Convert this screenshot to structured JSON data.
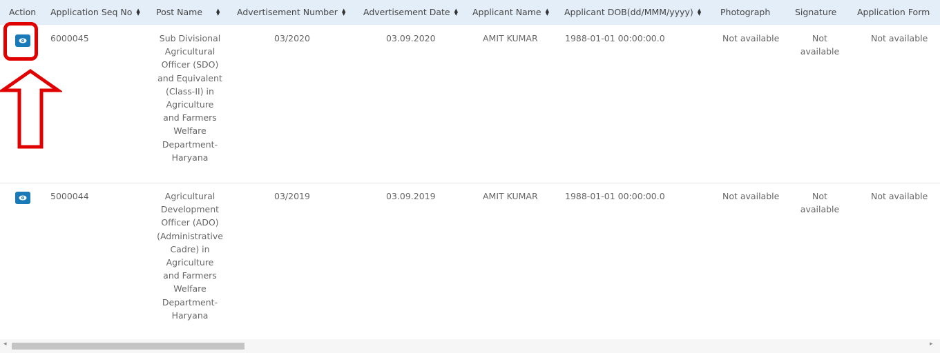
{
  "table": {
    "columns": [
      {
        "label": "Action",
        "sortable": false
      },
      {
        "label": "Application Seq No",
        "sortable": true
      },
      {
        "label": "Post Name",
        "sortable": true
      },
      {
        "label": "Advertisement Number",
        "sortable": true
      },
      {
        "label": "Advertisement Date",
        "sortable": true
      },
      {
        "label": "Applicant Name",
        "sortable": true
      },
      {
        "label": "Applicant DOB(dd/MMM/yyyy)",
        "sortable": true
      },
      {
        "label": "Photograph",
        "sortable": false
      },
      {
        "label": "Signature",
        "sortable": false
      },
      {
        "label": "Application Form",
        "sortable": false
      }
    ],
    "rows": [
      {
        "action_icon": "eye-icon",
        "seq_no": "6000045",
        "post_name_lines": [
          "Sub Divisional",
          "Agricultural",
          "Officer (SDO)",
          "and Equivalent",
          "(Class-II) in",
          "Agriculture",
          "and Farmers",
          "Welfare",
          "Department-",
          "Haryana"
        ],
        "adv_number": "03/2020",
        "adv_date": "03.09.2020",
        "applicant_name": "AMIT KUMAR",
        "dob": "1988-01-01 00:00:00.0",
        "photograph": "Not available",
        "signature_lines": [
          "Not",
          "available"
        ],
        "application_form": "Not available"
      },
      {
        "action_icon": "eye-icon",
        "seq_no": "5000044",
        "post_name_lines": [
          "Agricultural",
          "Development",
          "Officer (ADO)",
          "(Administrative",
          "Cadre) in",
          "Agriculture",
          "and Farmers",
          "Welfare",
          "Department-",
          "Haryana"
        ],
        "adv_number": "03/2019",
        "adv_date": "03.09.2019",
        "applicant_name": "AMIT KUMAR",
        "dob": "1988-01-01 00:00:00.0",
        "photograph": "Not available",
        "signature_lines": [
          "Not",
          "available"
        ],
        "application_form": "Not available"
      }
    ]
  },
  "annotation": {
    "highlight_color": "#e00000",
    "arrow_direction": "up"
  },
  "colors": {
    "header_bg": "#e3eef8",
    "button_bg": "#1a7ab8"
  }
}
